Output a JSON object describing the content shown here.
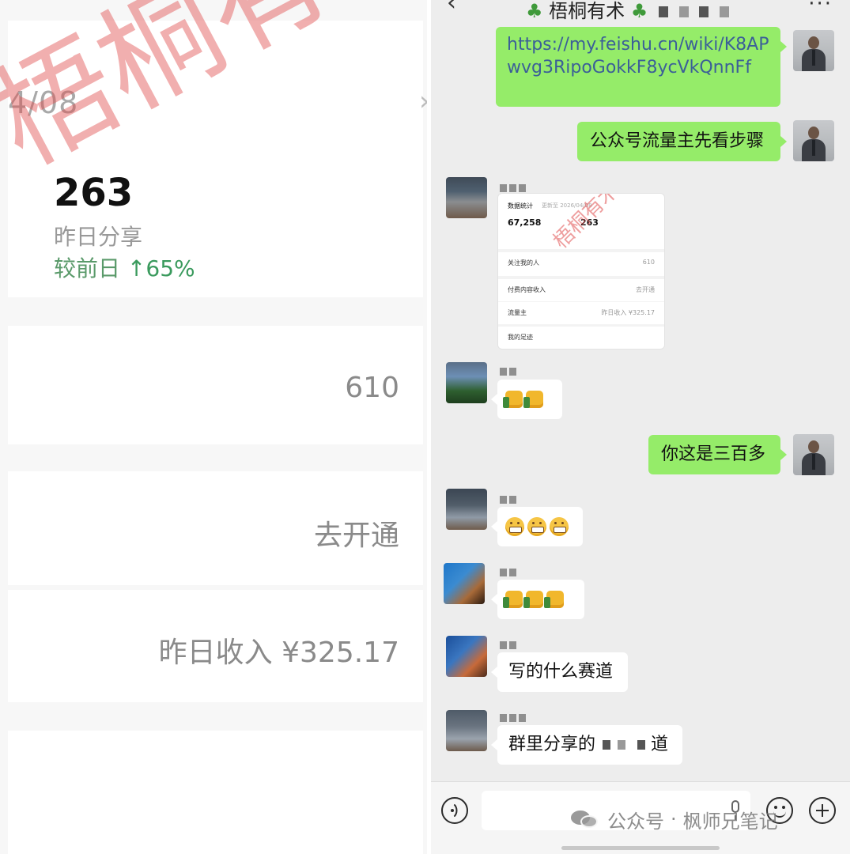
{
  "left": {
    "date": "4/08",
    "chevron": "›",
    "stat_value": "263",
    "stat_label": "昨日分享",
    "compare_prefix": "较前日",
    "compare_value": "↑65%",
    "followers": "610",
    "paid_content": "去开通",
    "income": "昨日收入 ¥325.17",
    "watermark": "梧桐有术"
  },
  "right": {
    "back_icon": "back-icon",
    "more_icon": "more-icon",
    "title": "梧桐有术",
    "messages": [
      {
        "sender": "me",
        "type": "text",
        "text": "https://my.feishu.cn/wiki/K8APwvg3RipoGokkF8ycVkQnnFf"
      },
      {
        "sender": "me",
        "type": "text",
        "text": "公众号流量主先看步骤"
      },
      {
        "sender": "other",
        "type": "image"
      },
      {
        "sender": "other",
        "type": "emoji",
        "emoji": [
          "thumbs-up",
          "thumbs-up"
        ]
      },
      {
        "sender": "me",
        "type": "text",
        "text": "你这是三百多"
      },
      {
        "sender": "other",
        "type": "emoji",
        "emoji": [
          "grin",
          "grin",
          "grin"
        ]
      },
      {
        "sender": "other",
        "type": "emoji",
        "emoji": [
          "thumbs-up",
          "thumbs-up",
          "thumbs-up"
        ]
      },
      {
        "sender": "other",
        "type": "text",
        "text": "写的什么赛道"
      },
      {
        "sender": "other",
        "type": "text",
        "text": "群里分享的"
      },
      {
        "sender": "other",
        "type": "text",
        "text": "道"
      }
    ],
    "mini_card": {
      "title": "数据统计",
      "time": "更新至 2026/04/08",
      "num1": "67,258",
      "num2": "263",
      "rows": [
        {
          "label": "关注我的人",
          "value": "610"
        },
        {
          "label": "付费内容收入",
          "value": "去开通"
        },
        {
          "label": "流量主",
          "value": "昨日收入 ¥325.17"
        },
        {
          "label": "我的足迹",
          "value": ""
        }
      ],
      "watermark": "梧桐有术"
    },
    "input_placeholder": "",
    "voice_icon": "voice-icon",
    "mic_icon": "mic-icon",
    "emoji_icon": "emoji-icon",
    "plus_icon": "plus-icon"
  },
  "footer": {
    "label": "公众号",
    "dot": "·",
    "name": "枫师兄笔记"
  },
  "colors": {
    "green_bubble": "#95ec69",
    "chat_bg": "#ededed",
    "up_green": "#3a9a5d",
    "watermark_red": "#e04e4e"
  }
}
